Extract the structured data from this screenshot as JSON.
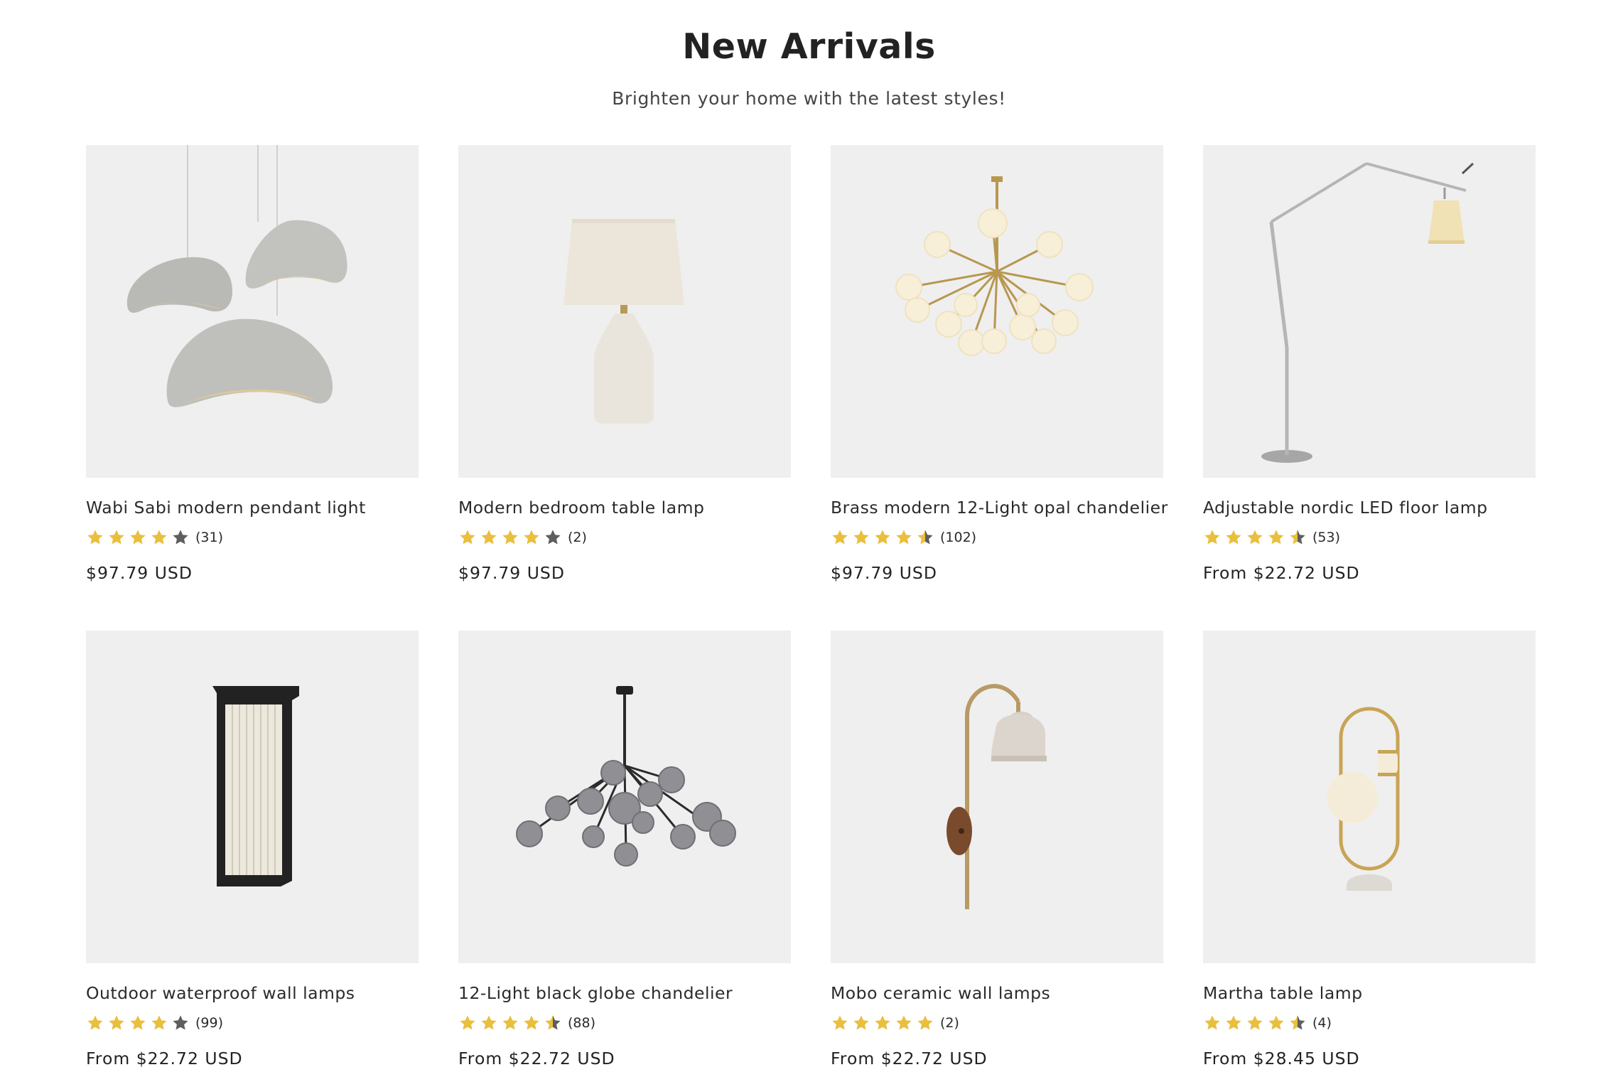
{
  "section": {
    "title": "New Arrivals",
    "subtitle": "Brighten your home with the latest styles!"
  },
  "colors": {
    "star_filled": "#e9bf3e",
    "star_empty": "#5e5e5e",
    "image_bg": "#efefef"
  },
  "products": [
    {
      "name": "Wabi Sabi modern pendant light",
      "rating": 4,
      "review_count": "(31)",
      "price": "$97.79 USD",
      "icon": "pendant-light-icon"
    },
    {
      "name": "Modern bedroom table lamp",
      "rating": 4,
      "review_count": "(2)",
      "price": "$97.79 USD",
      "icon": "table-lamp-icon"
    },
    {
      "name": "Brass modern 12-Light opal chandelier",
      "rating": 4.5,
      "review_count": "(102)",
      "price": "$97.79 USD",
      "icon": "chandelier-icon"
    },
    {
      "name": "Adjustable nordic LED floor lamp",
      "rating": 4.5,
      "review_count": "(53)",
      "price": "From $22.72 USD",
      "icon": "floor-lamp-icon"
    },
    {
      "name": "Outdoor waterproof wall lamps",
      "rating": 4,
      "review_count": "(99)",
      "price": "From $22.72 USD",
      "icon": "wall-lamp-icon"
    },
    {
      "name": "12-Light black globe chandelier",
      "rating": 4.5,
      "review_count": "(88)",
      "price": "From $22.72 USD",
      "icon": "globe-chandelier-icon"
    },
    {
      "name": "Mobo ceramic wall lamps",
      "rating": 5,
      "review_count": "(2)",
      "price": "From $22.72 USD",
      "icon": "ceramic-wall-lamp-icon"
    },
    {
      "name": "Martha table lamp",
      "rating": 4.5,
      "review_count": "(4)",
      "price": "From $28.45 USD",
      "icon": "globe-table-lamp-icon"
    }
  ]
}
